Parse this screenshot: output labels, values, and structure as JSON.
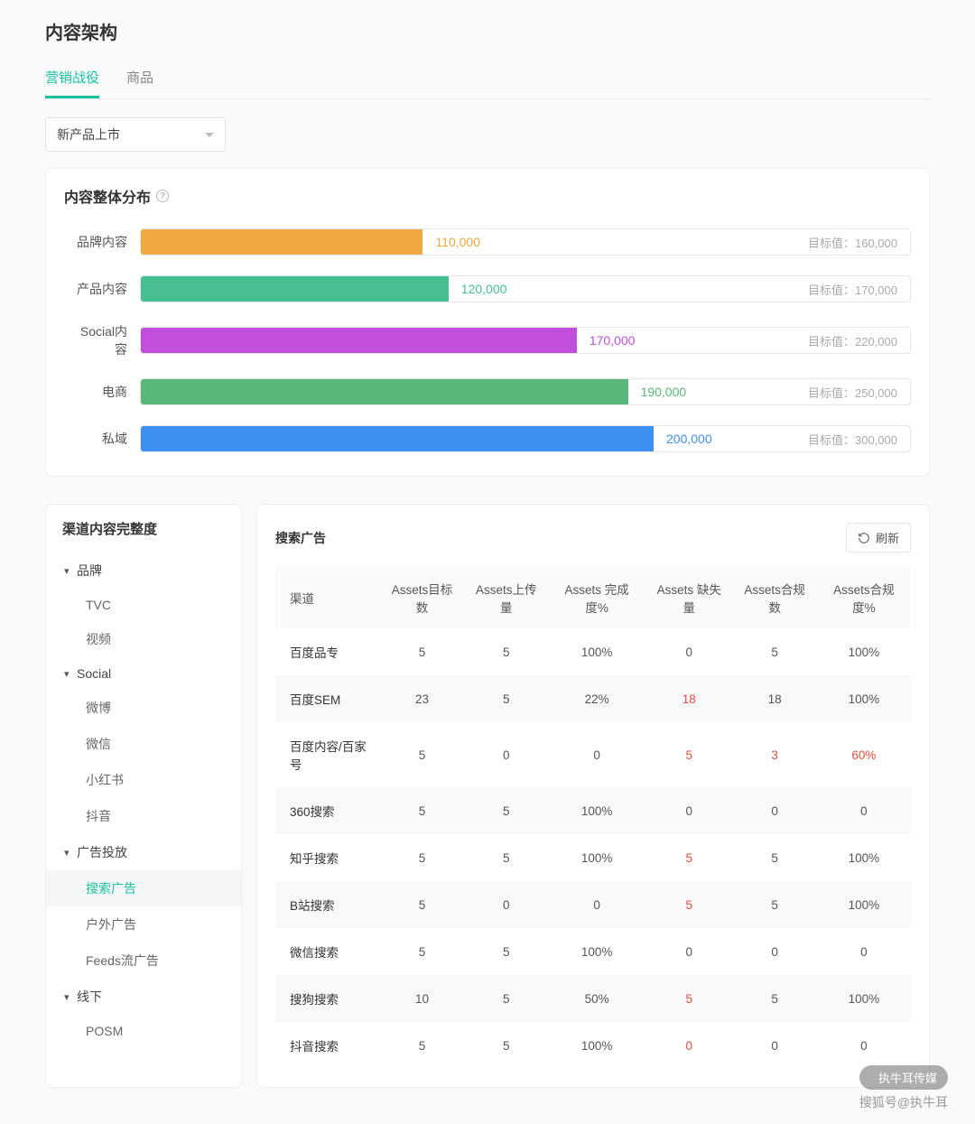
{
  "page": {
    "title": "内容架构",
    "tabs": [
      "营销战役",
      "商品"
    ],
    "active_tab": 0,
    "select_value": "新产品上市"
  },
  "overview": {
    "title": "内容整体分布",
    "target_prefix": "目标值：",
    "max_target": 300000
  },
  "chart_data": {
    "type": "bar",
    "xlabel": "",
    "ylabel": "",
    "categories": [
      "品牌内容",
      "产品内容",
      "Social内容",
      "电商",
      "私域"
    ],
    "series": [
      {
        "name": "value",
        "values": [
          110000,
          120000,
          170000,
          190000,
          200000
        ]
      },
      {
        "name": "target",
        "values": [
          160000,
          170000,
          220000,
          250000,
          300000
        ]
      }
    ],
    "display_values": [
      "110,000",
      "120,000",
      "170,000",
      "190,000",
      "200,000"
    ],
    "display_targets": [
      "160,000",
      "170,000",
      "220,000",
      "250,000",
      "300,000"
    ],
    "colors": [
      "#f0a841",
      "#47bf93",
      "#c24fdc",
      "#59b67a",
      "#3d8ff0"
    ]
  },
  "tree": {
    "title": "渠道内容完整度",
    "groups": [
      {
        "label": "品牌",
        "items": [
          "TVC",
          "视频"
        ]
      },
      {
        "label": "Social",
        "items": [
          "微博",
          "微信",
          "小红书",
          "抖音"
        ]
      },
      {
        "label": "广告投放",
        "items": [
          "搜索广告",
          "户外广告",
          "Feeds流广告"
        ],
        "active": "搜索广告"
      },
      {
        "label": "线下",
        "items": [
          "POSM"
        ]
      }
    ]
  },
  "table": {
    "title": "搜索广告",
    "refresh_label": "刷新",
    "columns": [
      "渠道",
      "Assets目标数",
      "Assets上传量",
      "Assets 完成度%",
      "Assets 缺失量",
      "Assets合规数",
      "Assets合规度%"
    ],
    "rows": [
      {
        "channel": "百度品专",
        "target": "5",
        "uploaded": "5",
        "complete": "100%",
        "missing": "0",
        "compliant": "5",
        "compliance": "100%",
        "missing_red": false,
        "compliant_red": false,
        "compliance_red": false
      },
      {
        "channel": "百度SEM",
        "target": "23",
        "uploaded": "5",
        "complete": "22%",
        "missing": "18",
        "compliant": "18",
        "compliance": "100%",
        "missing_red": true,
        "compliant_red": false,
        "compliance_red": false
      },
      {
        "channel": "百度内容/百家号",
        "target": "5",
        "uploaded": "0",
        "complete": "0",
        "missing": "5",
        "compliant": "3",
        "compliance": "60%",
        "missing_red": true,
        "compliant_red": true,
        "compliance_red": true
      },
      {
        "channel": "360搜索",
        "target": "5",
        "uploaded": "5",
        "complete": "100%",
        "missing": "0",
        "compliant": "0",
        "compliance": "0",
        "missing_red": false,
        "compliant_red": false,
        "compliance_red": false
      },
      {
        "channel": "知乎搜索",
        "target": "5",
        "uploaded": "5",
        "complete": "100%",
        "missing": "5",
        "compliant": "5",
        "compliance": "100%",
        "missing_red": true,
        "compliant_red": false,
        "compliance_red": false
      },
      {
        "channel": "B站搜索",
        "target": "5",
        "uploaded": "0",
        "complete": "0",
        "missing": "5",
        "compliant": "5",
        "compliance": "100%",
        "missing_red": true,
        "compliant_red": false,
        "compliance_red": false
      },
      {
        "channel": "微信搜索",
        "target": "5",
        "uploaded": "5",
        "complete": "100%",
        "missing": "0",
        "compliant": "0",
        "compliance": "0",
        "missing_red": false,
        "compliant_red": false,
        "compliance_red": false
      },
      {
        "channel": "搜狗搜索",
        "target": "10",
        "uploaded": "5",
        "complete": "50%",
        "missing": "5",
        "compliant": "5",
        "compliance": "100%",
        "missing_red": true,
        "compliant_red": false,
        "compliance_red": false
      },
      {
        "channel": "抖音搜索",
        "target": "5",
        "uploaded": "5",
        "complete": "100%",
        "missing": "0",
        "compliant": "0",
        "compliance": "0",
        "missing_red": true,
        "compliant_red": false,
        "compliance_red": false
      }
    ]
  },
  "watermark": {
    "bubble": "执牛耳传媒",
    "account": "搜狐号@执牛耳"
  }
}
